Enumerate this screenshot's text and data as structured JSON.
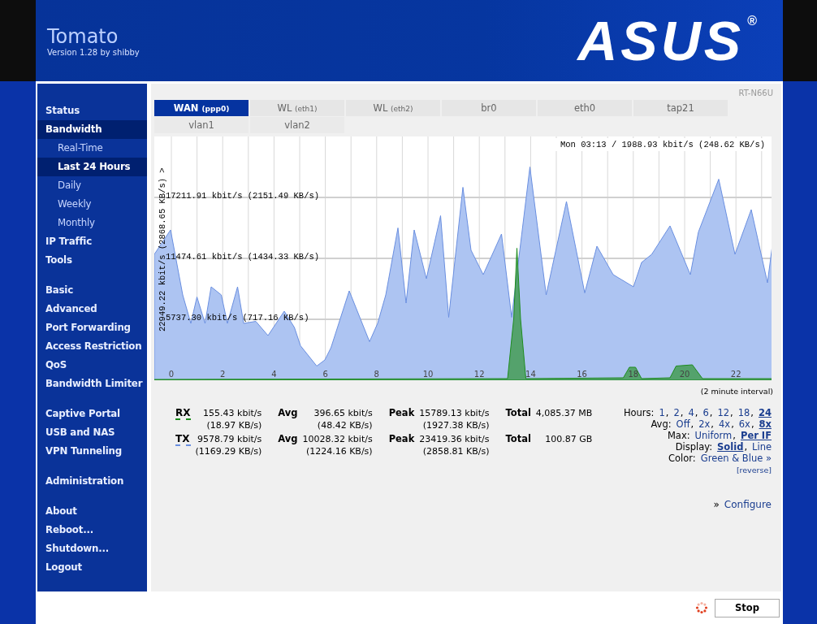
{
  "header": {
    "title": "Tomato",
    "version": "Version 1.28 by shibby",
    "logo": "ASUS",
    "logo_mark": "®"
  },
  "sidebar": {
    "groups": [
      [
        {
          "label": "Status",
          "kind": "main",
          "selected": false
        },
        {
          "label": "Bandwidth",
          "kind": "main",
          "selected": true
        },
        {
          "label": "Real-Time",
          "kind": "sub",
          "selected": false
        },
        {
          "label": "Last 24 Hours",
          "kind": "sub",
          "selected": true
        },
        {
          "label": "Daily",
          "kind": "sub",
          "selected": false
        },
        {
          "label": "Weekly",
          "kind": "sub",
          "selected": false
        },
        {
          "label": "Monthly",
          "kind": "sub",
          "selected": false
        },
        {
          "label": "IP Traffic",
          "kind": "main",
          "selected": false
        },
        {
          "label": "Tools",
          "kind": "main",
          "selected": false
        }
      ],
      [
        {
          "label": "Basic",
          "kind": "main",
          "selected": false
        },
        {
          "label": "Advanced",
          "kind": "main",
          "selected": false
        },
        {
          "label": "Port Forwarding",
          "kind": "main",
          "selected": false
        },
        {
          "label": "Access Restriction",
          "kind": "main",
          "selected": false
        },
        {
          "label": "QoS",
          "kind": "main",
          "selected": false
        },
        {
          "label": "Bandwidth Limiter",
          "kind": "main",
          "selected": false
        }
      ],
      [
        {
          "label": "Captive Portal",
          "kind": "main",
          "selected": false
        },
        {
          "label": "USB and NAS",
          "kind": "main",
          "selected": false
        },
        {
          "label": "VPN Tunneling",
          "kind": "main",
          "selected": false
        }
      ],
      [
        {
          "label": "Administration",
          "kind": "main",
          "selected": false
        }
      ],
      [
        {
          "label": "About",
          "kind": "main",
          "selected": false
        },
        {
          "label": "Reboot...",
          "kind": "main",
          "selected": false
        },
        {
          "label": "Shutdown...",
          "kind": "main",
          "selected": false
        },
        {
          "label": "Logout",
          "kind": "main",
          "selected": false
        }
      ]
    ]
  },
  "router_model": "RT-N66U",
  "tabs": [
    {
      "label": "WAN",
      "detail": "(ppp0)",
      "selected": true
    },
    {
      "label": "WL",
      "detail": "(eth1)",
      "selected": false
    },
    {
      "label": "WL",
      "detail": "(eth2)",
      "selected": false
    },
    {
      "label": "br0",
      "selected": false
    },
    {
      "label": "eth0",
      "selected": false
    },
    {
      "label": "tap21",
      "selected": false
    },
    {
      "label": "vlan1",
      "selected": false
    },
    {
      "label": "vlan2",
      "selected": false
    }
  ],
  "graph": {
    "current": "Mon 03:13 / 1988.93 kbit/s (248.62 KB/s)",
    "max_label": "22949.22 kbit/s (2868.65 KB/s) >",
    "grid_labels": [
      "17211.91 kbit/s (2151.49 KB/s)",
      "11474.61 kbit/s (1434.33 KB/s)",
      "5737.30 kbit/s (717.16 KB/s)"
    ],
    "hour_labels": [
      "0",
      "2",
      "4",
      "6",
      "8",
      "10",
      "12",
      "14",
      "16",
      "18",
      "20",
      "22"
    ],
    "interval": "(2 minute interval)"
  },
  "stats": [
    {
      "name": "RX",
      "color": "#1e8c1e",
      "current": [
        "155.43 kbit/s",
        "(18.97 KB/s)"
      ],
      "avg_label": "Avg",
      "avg": [
        "396.65 kbit/s",
        "(48.42 KB/s)"
      ],
      "peak_label": "Peak",
      "peak": [
        "15789.13 kbit/s",
        "(1927.38 KB/s)"
      ],
      "total_label": "Total",
      "total": "4,085.37 MB"
    },
    {
      "name": "TX",
      "color": "#6a8fe0",
      "current": [
        "9578.79 kbit/s",
        "(1169.29 KB/s)"
      ],
      "avg_label": "Avg",
      "avg": [
        "10028.32 kbit/s",
        "(1224.16 KB/s)"
      ],
      "peak_label": "Peak",
      "peak": [
        "23419.36 kbit/s",
        "(2858.81 KB/s)"
      ],
      "total_label": "Total",
      "total": "100.87 GB"
    }
  ],
  "options": [
    {
      "label": "Hours:",
      "separator": ",",
      "choices": [
        {
          "label": "1",
          "selected": false
        },
        {
          "label": "2",
          "selected": false
        },
        {
          "label": "4",
          "selected": false
        },
        {
          "label": "6",
          "selected": false
        },
        {
          "label": "12",
          "selected": false
        },
        {
          "label": "18",
          "selected": false
        },
        {
          "label": "24",
          "selected": true
        }
      ]
    },
    {
      "label": "Avg:",
      "separator": ",",
      "choices": [
        {
          "label": "Off",
          "selected": false
        },
        {
          "label": "2x",
          "selected": false
        },
        {
          "label": "4x",
          "selected": false
        },
        {
          "label": "6x",
          "selected": false
        },
        {
          "label": "8x",
          "selected": true
        }
      ]
    },
    {
      "label": "Max:",
      "separator": ",",
      "choices": [
        {
          "label": "Uniform",
          "selected": false
        },
        {
          "label": "Per IF",
          "selected": true
        }
      ]
    },
    {
      "label": "Display:",
      "separator": ",",
      "choices": [
        {
          "label": "Solid",
          "selected": true
        },
        {
          "label": "Line",
          "selected": false
        }
      ]
    },
    {
      "label": "Color:",
      "choices": [
        {
          "label": "Green & Blue »",
          "selected": false
        }
      ]
    }
  ],
  "reverse_link": "[reverse]",
  "configure": {
    "mark": "»",
    "link": "Configure"
  },
  "footer": {
    "button": "Stop"
  }
}
